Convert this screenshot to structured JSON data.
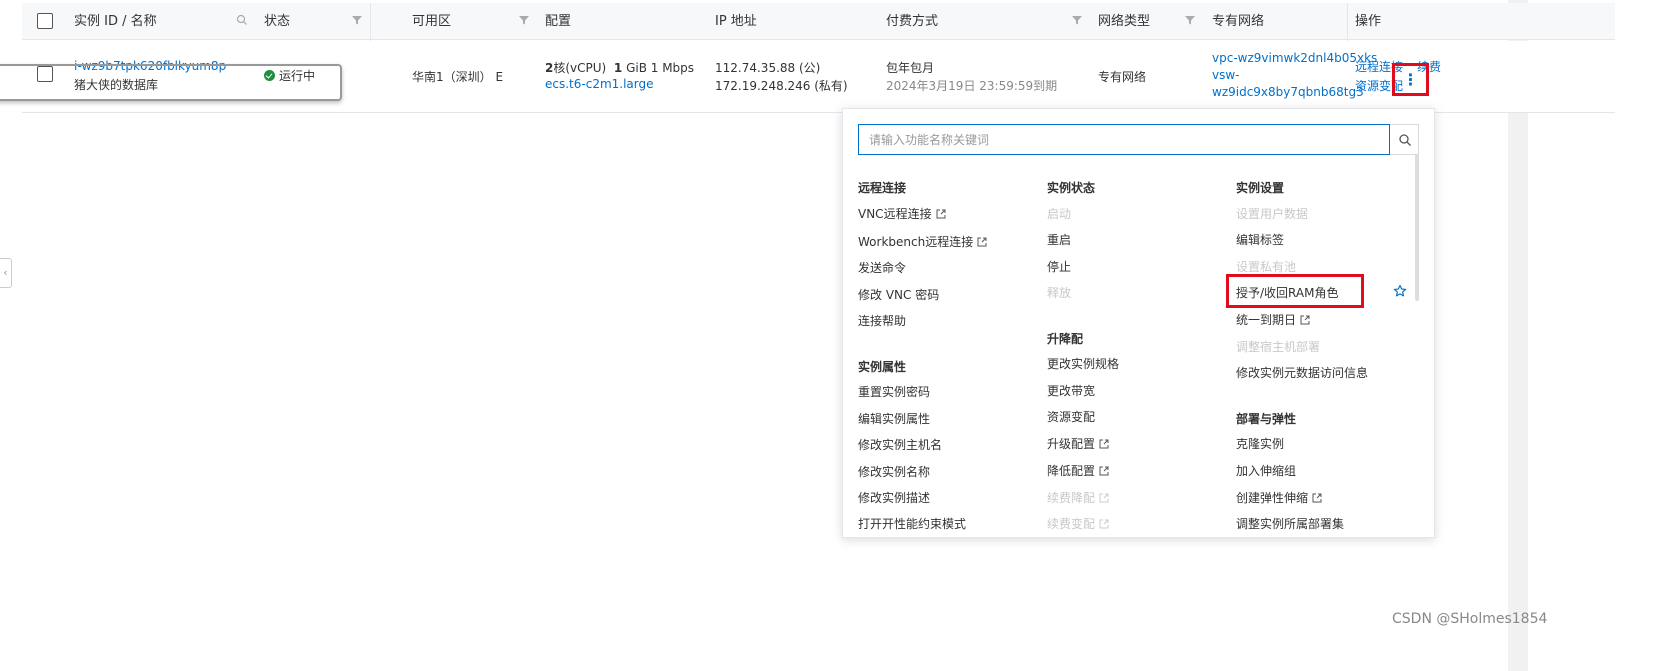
{
  "table": {
    "headers": {
      "instance_id_name": "实例 ID / 名称",
      "status": "状态",
      "zone": "可用区",
      "config": "配置",
      "ip": "IP 地址",
      "billing": "付费方式",
      "network_type": "网络类型",
      "vpc": "专有网络",
      "actions": "操作"
    },
    "row": {
      "instance_id": "i-wz9b7tpk620fblkyum8p",
      "instance_name": "猪大侠的数据库",
      "status": "运行中",
      "zone": "华南1（深圳） E",
      "config_cpu_num": "2",
      "config_cpu_unit": "核(vCPU)",
      "config_mem_num": "1",
      "config_mem_rest": "GiB 1 Mbps",
      "config_type": "ecs.t6-c2m1.large",
      "ip_public": "112.74.35.88 (公)",
      "ip_private": "172.19.248.246 (私有)",
      "billing_type": "包年包月",
      "billing_expire": "2024年3月19日 23:59:59到期",
      "network_type": "专有网络",
      "vpc_id": "vpc-wz9vimwk2dnl4b05xks",
      "vsw_prefix": "vsw-",
      "vsw_id": "wz9idc9x8by7qbnb68tg3",
      "action_remote": "远程连接",
      "action_renew": "续费",
      "action_resource": "资源变配",
      "more_glyph": "⋮"
    }
  },
  "panel": {
    "search_placeholder": "请输入功能名称关键词",
    "col1": {
      "group1_title": "远程连接",
      "group1_items": [
        "VNC远程连接",
        "Workbench远程连接",
        "发送命令",
        "修改 VNC 密码",
        "连接帮助"
      ],
      "group2_title": "实例属性",
      "group2_items": [
        "重置实例密码",
        "编辑实例属性",
        "修改实例主机名",
        "修改实例名称",
        "修改实例描述",
        "打开开性能约束模式"
      ]
    },
    "col2": {
      "group1_title": "实例状态",
      "group1_items": [
        "启动",
        "重启",
        "停止",
        "释放"
      ],
      "group2_title": "升降配",
      "group2_items": [
        "更改实例规格",
        "更改带宽",
        "资源变配",
        "升级配置",
        "降低配置",
        "续费降配",
        "续费变配"
      ]
    },
    "col3": {
      "group1_title": "实例设置",
      "group1_items": [
        "设置用户数据",
        "编辑标签",
        "设置私有池",
        "授予/收回RAM角色",
        "统一到期日",
        "调整宿主机部署",
        "修改实例元数据访问信息"
      ],
      "group2_title": "部署与弹性",
      "group2_items": [
        "克隆实例",
        "加入伸缩组",
        "创建弹性伸缩",
        "调整实例所属部署集"
      ]
    }
  },
  "left_handle_glyph": "‹",
  "watermark": "CSDN @SHolmes1854",
  "colors": {
    "link": "#0070cc",
    "highlight_red": "#e00b1c",
    "status_green": "#1e8e3e",
    "disabled": "#c8c8c8"
  }
}
